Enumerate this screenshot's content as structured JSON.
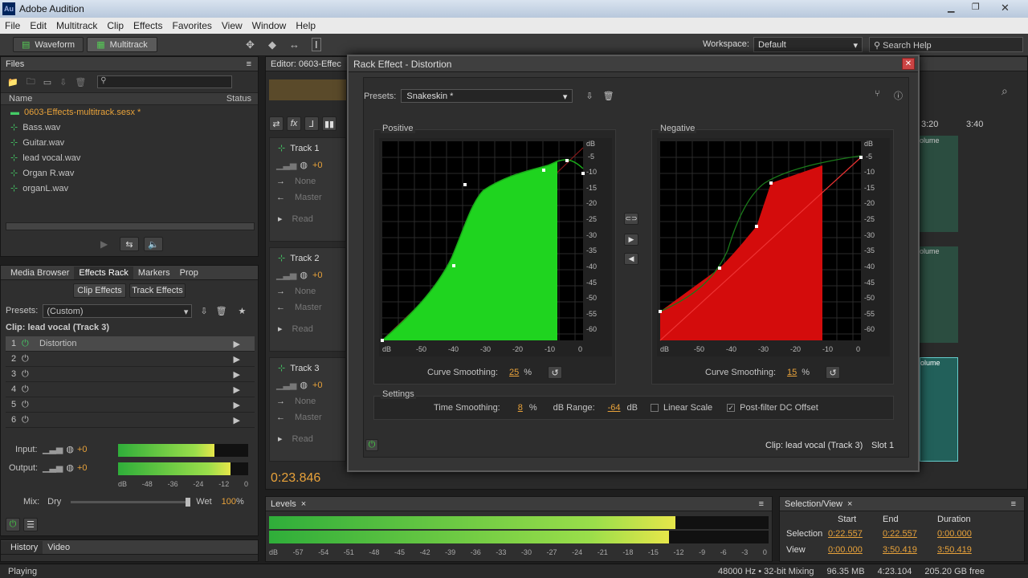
{
  "window": {
    "title": "Adobe Audition",
    "logo": "Au"
  },
  "menu": [
    "File",
    "Edit",
    "Multitrack",
    "Clip",
    "Effects",
    "Favorites",
    "View",
    "Window",
    "Help"
  ],
  "toolbar": {
    "waveform": "Waveform",
    "multitrack": "Multitrack",
    "workspace_label": "Workspace:",
    "workspace_value": "Default",
    "search_placeholder": "Search Help"
  },
  "files": {
    "title": "Files",
    "col_name": "Name",
    "col_status": "Status",
    "items": [
      "0603-Effects-multitrack.sesx *",
      "Bass.wav",
      "Guitar.wav",
      "lead vocal.wav",
      "Organ R.wav",
      "organL.wav"
    ]
  },
  "rack": {
    "tabs": [
      "Media Browser",
      "Effects Rack",
      "Markers",
      "Prop"
    ],
    "clip_effects": "Clip Effects",
    "track_effects": "Track Effects",
    "presets_label": "Presets:",
    "presets_value": "(Custom)",
    "clip_label": "Clip: lead vocal (Track 3)",
    "slots": [
      {
        "n": "1",
        "name": "Distortion"
      },
      {
        "n": "2",
        "name": ""
      },
      {
        "n": "3",
        "name": ""
      },
      {
        "n": "4",
        "name": ""
      },
      {
        "n": "5",
        "name": ""
      },
      {
        "n": "6",
        "name": ""
      }
    ],
    "input_label": "Input:",
    "input_val": "+0",
    "output_label": "Output:",
    "output_val": "+0",
    "scale": [
      "dB",
      "-48",
      "-36",
      "-24",
      "-12",
      "0"
    ],
    "mix_label": "Mix:",
    "dry": "Dry",
    "wet": "Wet",
    "wet_val": "100",
    "pct": "%"
  },
  "history": {
    "tab1": "History",
    "tab2": "Video"
  },
  "status": {
    "left": "Playing",
    "format": "48000 Hz • 32-bit Mixing",
    "mem": "96.35 MB",
    "dur": "4:23.104",
    "free": "205.20 GB free"
  },
  "editor": {
    "title": "Editor: 0603-Effec",
    "tracks": [
      {
        "name": "Track 1",
        "vol": "+0",
        "in": "None",
        "out": "Master",
        "mode": "Read"
      },
      {
        "name": "Track 2",
        "vol": "+0",
        "in": "None",
        "out": "Master",
        "mode": "Read"
      },
      {
        "name": "Track 3",
        "vol": "+0",
        "in": "None",
        "out": "Master",
        "mode": "Read"
      }
    ],
    "time": "0:23.846",
    "ruler": [
      "3:20",
      "3:40"
    ],
    "vol_label": "olume"
  },
  "levels": {
    "title": "Levels",
    "scale": [
      "dB",
      "-57",
      "-54",
      "-51",
      "-48",
      "-45",
      "-42",
      "-39",
      "-36",
      "-33",
      "-30",
      "-27",
      "-24",
      "-21",
      "-18",
      "-15",
      "-12",
      "-9",
      "-6",
      "-3",
      "0"
    ]
  },
  "selview": {
    "title": "Selection/View",
    "cols": [
      "Start",
      "End",
      "Duration"
    ],
    "rows": [
      {
        "label": "Selection",
        "start": "0:22.557",
        "end": "0:22.557",
        "dur": "0:00.000"
      },
      {
        "label": "View",
        "start": "0:00.000",
        "end": "3:50.419",
        "dur": "3:50.419"
      }
    ]
  },
  "dialog": {
    "title": "Rack Effect - Distortion",
    "presets_label": "Presets:",
    "preset": "Snakeskin *",
    "positive": "Positive",
    "negative": "Negative",
    "curve_label": "Curve Smoothing:",
    "pos_smooth": "25",
    "neg_smooth": "15",
    "pct": "%",
    "db_top": "dB",
    "db_ticks": [
      "-5",
      "-10",
      "-15",
      "-20",
      "-25",
      "-30",
      "-35",
      "-40",
      "-45",
      "-50",
      "-55",
      "-60"
    ],
    "x_ticks": [
      "dB",
      "-50",
      "-40",
      "-30",
      "-20",
      "-10",
      "0"
    ],
    "settings": "Settings",
    "time_smooth_label": "Time Smoothing:",
    "time_smooth": "8",
    "db_range_label": "dB Range:",
    "db_range": "-64",
    "db": "dB",
    "linear": "Linear Scale",
    "postfilter": "Post-filter DC Offset",
    "clip": "Clip: lead vocal (Track 3)",
    "slot": "Slot 1"
  },
  "colors": {
    "positive": "#1fd41f",
    "negative": "#d40c0c",
    "accent": "#e8a23a"
  }
}
